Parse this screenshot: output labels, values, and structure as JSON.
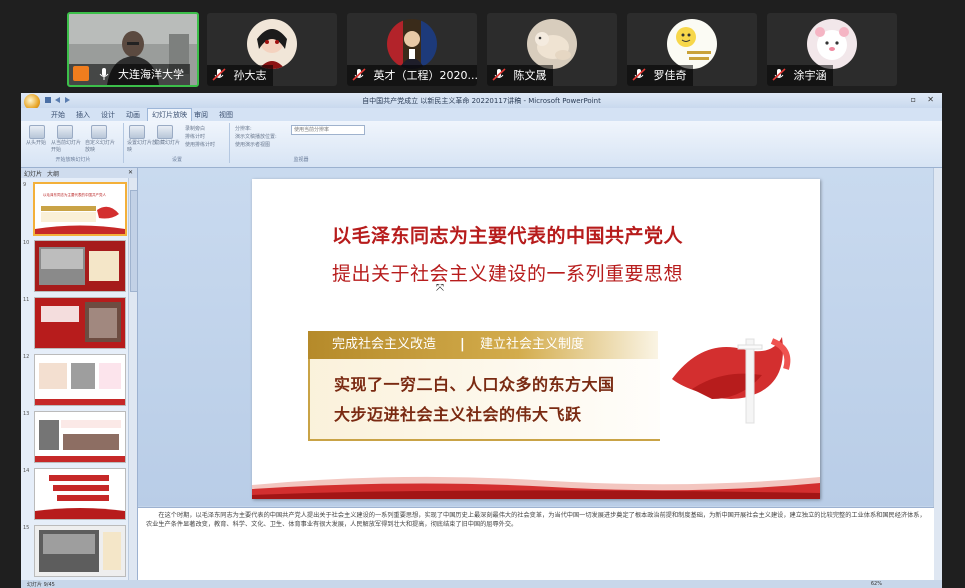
{
  "participants": [
    {
      "name": "大连海洋大学",
      "host": true,
      "muted": false
    },
    {
      "name": "孙大志",
      "host": false,
      "muted": true
    },
    {
      "name": "英才（工程）2020...",
      "host": false,
      "muted": true
    },
    {
      "name": "陈文晟",
      "host": false,
      "muted": true
    },
    {
      "name": "罗佳奇",
      "host": false,
      "muted": true
    },
    {
      "name": "涂宇涵",
      "host": false,
      "muted": true
    }
  ],
  "ppt": {
    "window_title": "自中国共产党成立 以新民主义革命 20220117讲稿 - Microsoft PowerPoint",
    "tabs": [
      "开始",
      "插入",
      "设计",
      "动画",
      "幻灯片放映",
      "审阅",
      "视图"
    ],
    "active_tab": "幻灯片放映",
    "ribbon": {
      "group1_label": "开始放映幻灯片",
      "group2_label": "设置",
      "group3_label": "监视器",
      "btn_from_start": "从头开始",
      "btn_from_current": "从当前幻灯片开始",
      "btn_custom": "自定义幻灯片放映",
      "btn_setup": "设置幻灯片放映",
      "btn_hide": "隐藏幻灯片",
      "opt_record": "录制旁白",
      "opt_rehearse": "排练计时",
      "opt_timings": "使用排练计时",
      "opt_resolution": "分辨率:",
      "opt_show_on": "演示文稿播放位置:",
      "opt_presenter": "使用演示者视图",
      "dropdown_value": "使用当前分辨率"
    },
    "left_tabs": [
      "幻灯片",
      "大纲"
    ],
    "slide_numbers": [
      "9",
      "10",
      "11",
      "12",
      "13",
      "14",
      "15"
    ],
    "status_left": "幻灯片 9/45",
    "zoom": "62%"
  },
  "slide": {
    "title1": "以毛泽东同志为主要代表的中国共产党人",
    "title2": "提出关于社会主义建设的一系列重要思想",
    "tag1": "完成社会主义改造",
    "tag_sep": "|",
    "tag2": "建立社会主义制度",
    "line1": "实现了一穷二白、人口众多的东方大国",
    "line2": "大步迈进社会主义社会的伟大飞跃"
  },
  "notes_text": "在这个时期，以毛泽东同志为主要代表的中国共产党人提出关于社会主义建设的一系列重要思想，实现了中国历史上最深刻最伟大的社会变革，为当代中国一切发展进步奠定了根本政治前提和制度基础，为新中国开展社会主义建设，建立独立的比较完整的工业体系和国民经济体系，农业生产条件显著改变，教育、科学、文化、卫生、体育事业有很大发展，人民解放军得到壮大和提高，彻底结束了旧中国的屈辱外交。",
  "colors": {
    "accent_red": "#b71c1c",
    "gold": "#c9a346",
    "active_border": "#3cbf4a"
  }
}
